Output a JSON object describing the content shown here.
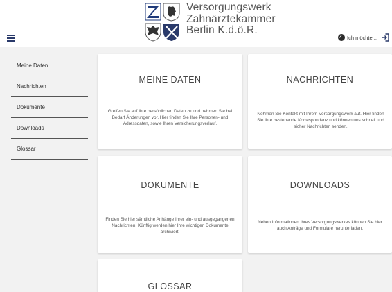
{
  "header": {
    "org_lines": [
      "Versorgungswerk",
      "Zahnärztekammer",
      "Berlin K.d.ö.R."
    ],
    "action_label": "Ich möchte...",
    "accent_color": "#2a3a6a"
  },
  "icons": {
    "menu": "hamburger-menu-icon",
    "action": "pointer-badge-icon",
    "logout": "logout-icon"
  },
  "sidebar": {
    "items": [
      {
        "label": "Meine Daten"
      },
      {
        "label": "Nachrichten"
      },
      {
        "label": "Dokumente"
      },
      {
        "label": "Downloads"
      },
      {
        "label": "Glossar"
      }
    ]
  },
  "cards": {
    "meine_daten": {
      "title": "MEINE DATEN",
      "desc": "Greifen Sie auf Ihre persönlichen Daten zu und nehmen Sie bei Bedarf Änderungen vor. Hier finden Sie Ihre Personen- und Adressdaten, sowie Ihren Versicherungsverlauf."
    },
    "nachrichten": {
      "title": "NACHRICHTEN",
      "desc": "Nehmen Sie Kontakt mit Ihrem Versorgungswerk auf. Hier finden Sie Ihre bestehende Korrespondenz und können uns schnell und sicher Nachrichten senden."
    },
    "dokumente": {
      "title": "DOKUMENTE",
      "desc": "Finden Sie hier sämtliche Anhänge Ihrer ein- und ausgegangenen Nachrichten. Künftig werden hier Ihre wichtigen Dokumente archiviert."
    },
    "downloads": {
      "title": "DOWNLOADS",
      "desc": "Neben Informationen Ihres Versorgungswerkes können Sie hier auch Anträge und Formulare herunterladen."
    },
    "glossar": {
      "title": "GLOSSAR"
    }
  }
}
